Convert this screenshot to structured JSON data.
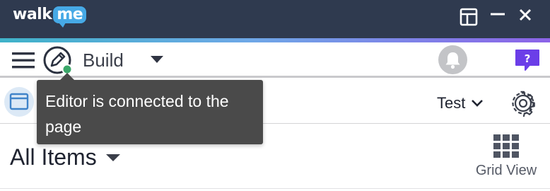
{
  "titlebar": {
    "logo_walk": "walk",
    "logo_me": "me",
    "bg_color": "#2f3a4f",
    "icons": [
      "layout-icon",
      "minimize-icon",
      "close-icon"
    ]
  },
  "toolbar": {
    "mode_label": "Build",
    "status_dot_color": "#3aa769",
    "icons": [
      "hamburger-menu-icon",
      "editor-pencil-icon",
      "chevron-down-icon",
      "bell-icon",
      "help-icon"
    ],
    "help_label": "?",
    "help_color": "#6b3ee8"
  },
  "tabbar": {
    "environment": "Test",
    "icons": [
      "page-window-icon",
      "chevron-down-icon",
      "gear-icon"
    ]
  },
  "tooltip": {
    "text": "Editor is connected to the page"
  },
  "list": {
    "filter_label": "All Items",
    "view_toggle_label": "Grid View",
    "icons": [
      "caret-down-icon",
      "grid-icon"
    ]
  }
}
